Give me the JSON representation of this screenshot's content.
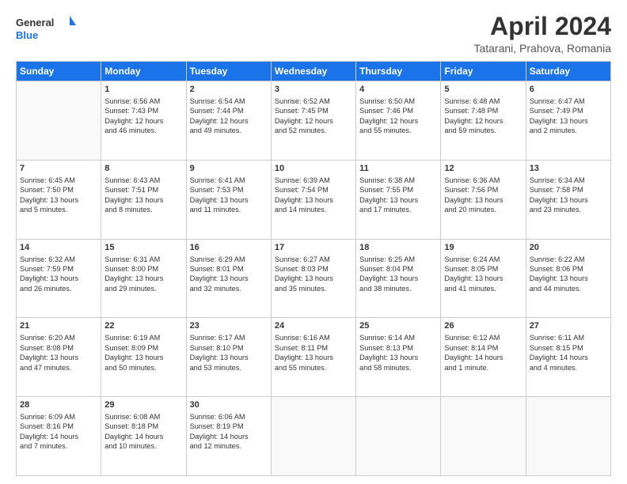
{
  "header": {
    "logo_line1": "General",
    "logo_line2": "Blue",
    "month_title": "April 2024",
    "subtitle": "Tatarani, Prahova, Romania"
  },
  "weekdays": [
    "Sunday",
    "Monday",
    "Tuesday",
    "Wednesday",
    "Thursday",
    "Friday",
    "Saturday"
  ],
  "weeks": [
    [
      {
        "day": "",
        "info": ""
      },
      {
        "day": "1",
        "info": "Sunrise: 6:56 AM\nSunset: 7:43 PM\nDaylight: 12 hours\nand 46 minutes."
      },
      {
        "day": "2",
        "info": "Sunrise: 6:54 AM\nSunset: 7:44 PM\nDaylight: 12 hours\nand 49 minutes."
      },
      {
        "day": "3",
        "info": "Sunrise: 6:52 AM\nSunset: 7:45 PM\nDaylight: 12 hours\nand 52 minutes."
      },
      {
        "day": "4",
        "info": "Sunrise: 6:50 AM\nSunset: 7:46 PM\nDaylight: 12 hours\nand 55 minutes."
      },
      {
        "day": "5",
        "info": "Sunrise: 6:48 AM\nSunset: 7:48 PM\nDaylight: 12 hours\nand 59 minutes."
      },
      {
        "day": "6",
        "info": "Sunrise: 6:47 AM\nSunset: 7:49 PM\nDaylight: 13 hours\nand 2 minutes."
      }
    ],
    [
      {
        "day": "7",
        "info": "Sunrise: 6:45 AM\nSunset: 7:50 PM\nDaylight: 13 hours\nand 5 minutes."
      },
      {
        "day": "8",
        "info": "Sunrise: 6:43 AM\nSunset: 7:51 PM\nDaylight: 13 hours\nand 8 minutes."
      },
      {
        "day": "9",
        "info": "Sunrise: 6:41 AM\nSunset: 7:53 PM\nDaylight: 13 hours\nand 11 minutes."
      },
      {
        "day": "10",
        "info": "Sunrise: 6:39 AM\nSunset: 7:54 PM\nDaylight: 13 hours\nand 14 minutes."
      },
      {
        "day": "11",
        "info": "Sunrise: 6:38 AM\nSunset: 7:55 PM\nDaylight: 13 hours\nand 17 minutes."
      },
      {
        "day": "12",
        "info": "Sunrise: 6:36 AM\nSunset: 7:56 PM\nDaylight: 13 hours\nand 20 minutes."
      },
      {
        "day": "13",
        "info": "Sunrise: 6:34 AM\nSunset: 7:58 PM\nDaylight: 13 hours\nand 23 minutes."
      }
    ],
    [
      {
        "day": "14",
        "info": "Sunrise: 6:32 AM\nSunset: 7:59 PM\nDaylight: 13 hours\nand 26 minutes."
      },
      {
        "day": "15",
        "info": "Sunrise: 6:31 AM\nSunset: 8:00 PM\nDaylight: 13 hours\nand 29 minutes."
      },
      {
        "day": "16",
        "info": "Sunrise: 6:29 AM\nSunset: 8:01 PM\nDaylight: 13 hours\nand 32 minutes."
      },
      {
        "day": "17",
        "info": "Sunrise: 6:27 AM\nSunset: 8:03 PM\nDaylight: 13 hours\nand 35 minutes."
      },
      {
        "day": "18",
        "info": "Sunrise: 6:25 AM\nSunset: 8:04 PM\nDaylight: 13 hours\nand 38 minutes."
      },
      {
        "day": "19",
        "info": "Sunrise: 6:24 AM\nSunset: 8:05 PM\nDaylight: 13 hours\nand 41 minutes."
      },
      {
        "day": "20",
        "info": "Sunrise: 6:22 AM\nSunset: 8:06 PM\nDaylight: 13 hours\nand 44 minutes."
      }
    ],
    [
      {
        "day": "21",
        "info": "Sunrise: 6:20 AM\nSunset: 8:08 PM\nDaylight: 13 hours\nand 47 minutes."
      },
      {
        "day": "22",
        "info": "Sunrise: 6:19 AM\nSunset: 8:09 PM\nDaylight: 13 hours\nand 50 minutes."
      },
      {
        "day": "23",
        "info": "Sunrise: 6:17 AM\nSunset: 8:10 PM\nDaylight: 13 hours\nand 53 minutes."
      },
      {
        "day": "24",
        "info": "Sunrise: 6:16 AM\nSunset: 8:11 PM\nDaylight: 13 hours\nand 55 minutes."
      },
      {
        "day": "25",
        "info": "Sunrise: 6:14 AM\nSunset: 8:13 PM\nDaylight: 13 hours\nand 58 minutes."
      },
      {
        "day": "26",
        "info": "Sunrise: 6:12 AM\nSunset: 8:14 PM\nDaylight: 14 hours\nand 1 minute."
      },
      {
        "day": "27",
        "info": "Sunrise: 6:11 AM\nSunset: 8:15 PM\nDaylight: 14 hours\nand 4 minutes."
      }
    ],
    [
      {
        "day": "28",
        "info": "Sunrise: 6:09 AM\nSunset: 8:16 PM\nDaylight: 14 hours\nand 7 minutes."
      },
      {
        "day": "29",
        "info": "Sunrise: 6:08 AM\nSunset: 8:18 PM\nDaylight: 14 hours\nand 10 minutes."
      },
      {
        "day": "30",
        "info": "Sunrise: 6:06 AM\nSunset: 8:19 PM\nDaylight: 14 hours\nand 12 minutes."
      },
      {
        "day": "",
        "info": ""
      },
      {
        "day": "",
        "info": ""
      },
      {
        "day": "",
        "info": ""
      },
      {
        "day": "",
        "info": ""
      }
    ]
  ]
}
